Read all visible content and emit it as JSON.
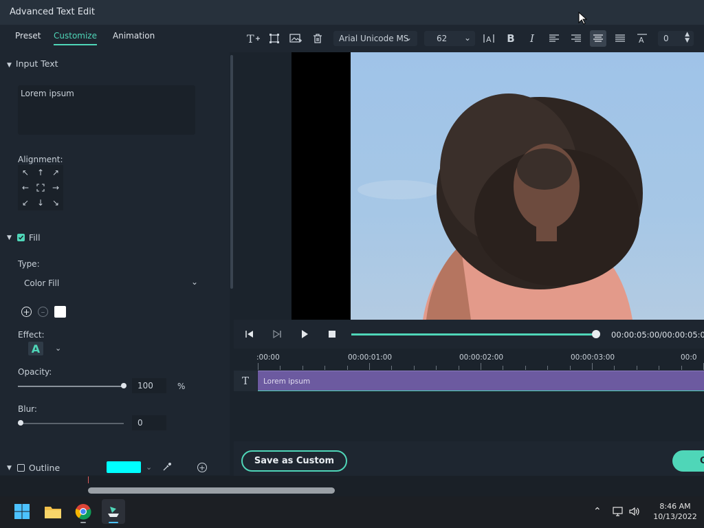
{
  "window": {
    "title": "Advanced Text Edit"
  },
  "tabs": [
    {
      "label": "Preset"
    },
    {
      "label": "Customize"
    },
    {
      "label": "Animation"
    }
  ],
  "toolbar": {
    "font": "Arial Unicode MS",
    "size": "62",
    "spacing_value": "0"
  },
  "left": {
    "input_text_header": "Input Text",
    "input_text_value": "Lorem ipsum",
    "alignment_label": "Alignment:",
    "fill_label": "Fill",
    "fill_checked": true,
    "type_label": "Type:",
    "type_value": "Color Fill",
    "fill_color": "#ffffff",
    "effect_label": "Effect:",
    "effect_glyph": "A",
    "opacity_label": "Opacity:",
    "opacity_value": "100",
    "opacity_unit": "%",
    "opacity_level": 1.0,
    "blur_label": "Blur:",
    "blur_value": "0",
    "blur_level": 0,
    "outline_label": "Outline",
    "outline_checked": false,
    "outline_color": "#00ffff"
  },
  "player": {
    "timecode": "00:00:05:00/00:00:05:00",
    "progress": 1.0
  },
  "timeline": {
    "ruler": [
      ":00:00",
      "00:00:01:00",
      "00:00:02:00",
      "00:00:03:00",
      "00:0"
    ],
    "track_icon": "T",
    "clip_label": "Lorem ipsum"
  },
  "buttons": {
    "save_custom": "Save as Custom",
    "ok_partial": "O"
  },
  "taskbar": {
    "time": "8:46 AM",
    "date": "10/13/2022"
  },
  "colors": {
    "accent": "#4fd6b8",
    "clip": "#6c5aa0",
    "panel": "#1e2630"
  }
}
